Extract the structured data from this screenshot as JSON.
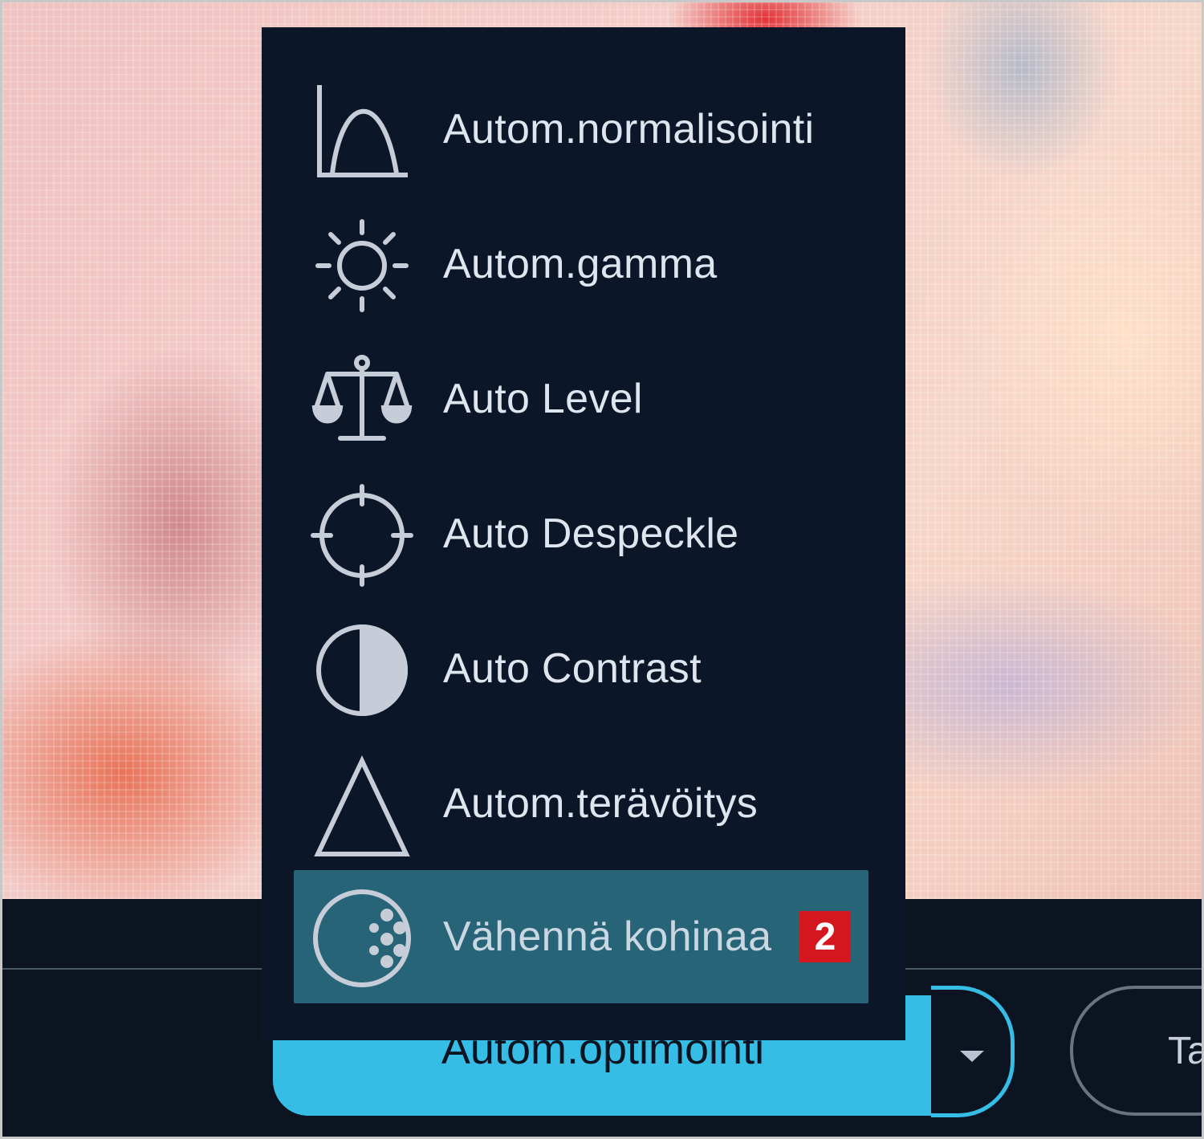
{
  "menu": {
    "items": [
      {
        "label": "Autom.normalisointi",
        "icon": "histogram-icon"
      },
      {
        "label": "Autom.gamma",
        "icon": "sun-icon"
      },
      {
        "label": "Auto Level",
        "icon": "scales-icon"
      },
      {
        "label": "Auto Despeckle",
        "icon": "crosshair-icon"
      },
      {
        "label": "Auto Contrast",
        "icon": "contrast-icon"
      },
      {
        "label": "Autom.terävöitys",
        "icon": "triangle-icon"
      },
      {
        "label": "Vähennä kohinaa",
        "icon": "noise-reduction-icon",
        "badge": "2",
        "highlighted": true
      }
    ]
  },
  "toolbar": {
    "auto_optimize_label": "Autom.optimointi",
    "next_button_label": "Ta"
  },
  "colors": {
    "menu_background": "#0b1628",
    "highlight": "#276477",
    "accent": "#35bde6",
    "badge": "#d4161f"
  }
}
